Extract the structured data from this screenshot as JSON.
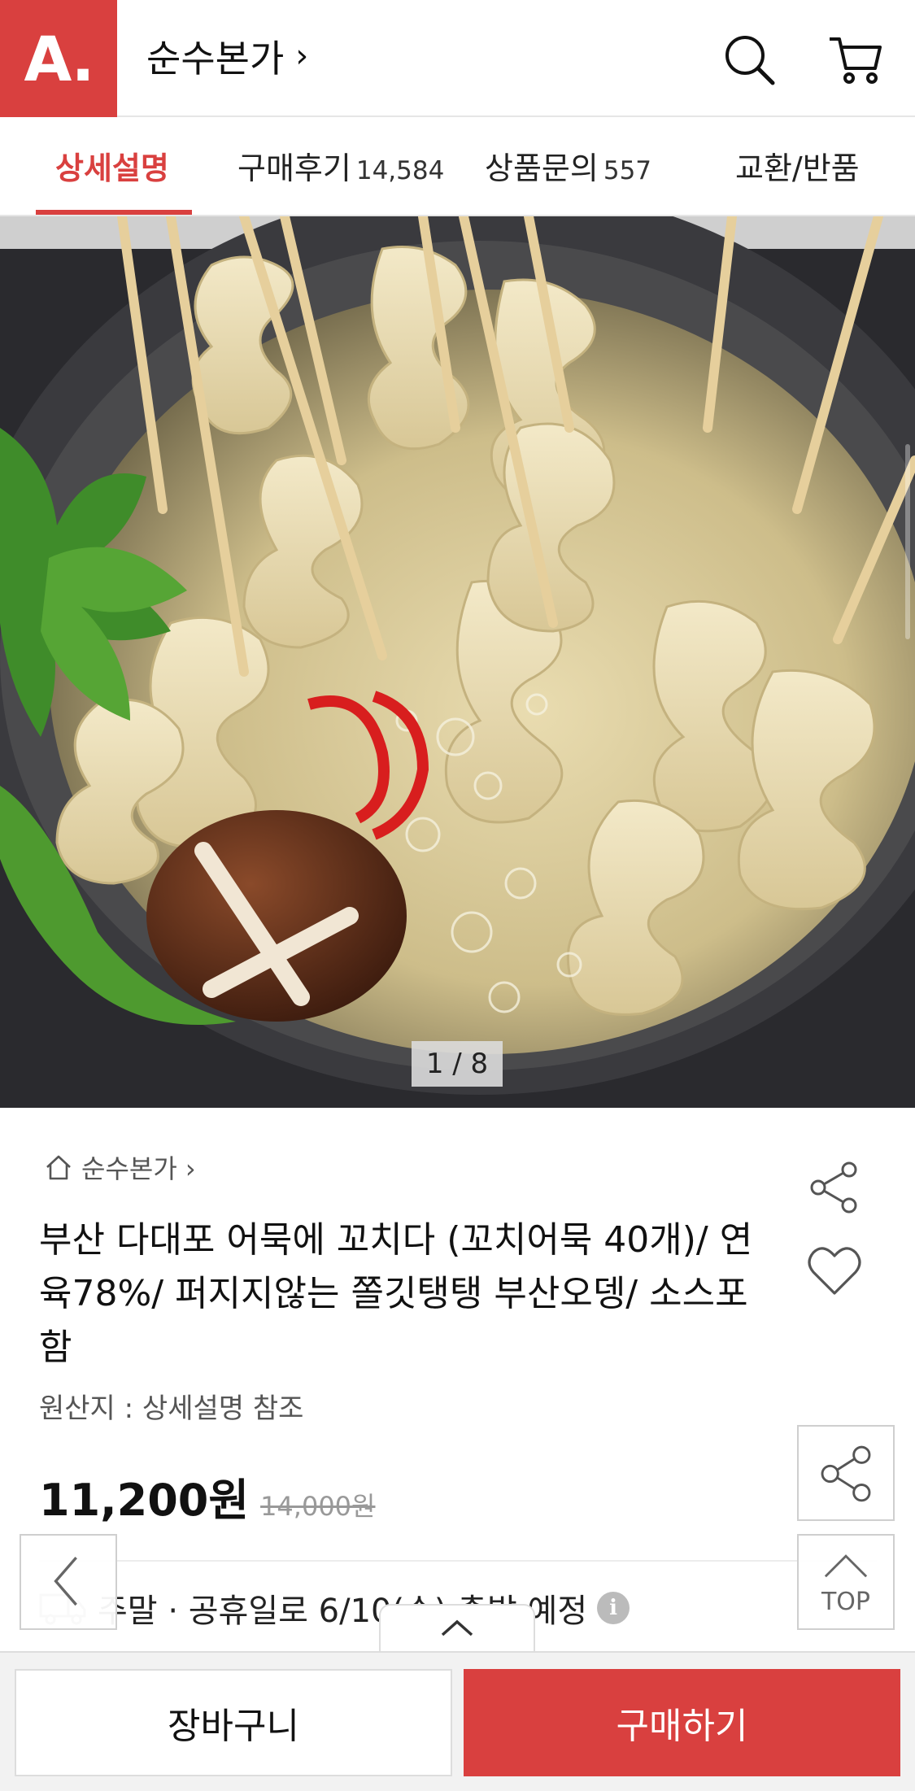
{
  "header": {
    "logo_text": "A.",
    "store_name": "순수본가",
    "chevron": "›",
    "icons": [
      "search-icon",
      "cart-icon"
    ]
  },
  "tabs": [
    {
      "label": "상세설명",
      "count": "",
      "active": true
    },
    {
      "label": "구매후기",
      "count": "14,584",
      "active": false
    },
    {
      "label": "상품문의",
      "count": "557",
      "active": false
    },
    {
      "label": "교환/반품",
      "count": "",
      "active": false
    }
  ],
  "gallery": {
    "counter": "1 / 8",
    "current": 1,
    "total": 8
  },
  "product": {
    "breadcrumb": "순수본가 ›",
    "title": "부산 다대포 어묵에 꼬치다 (꼬치어묵 40개)/ 연육78%/ 퍼지지않는 쫄깃탱탱 부산오뎅/ 소스포함",
    "origin": "원산지 : 상세설명 참조",
    "price": "11,200원",
    "original_price": "14,000원",
    "shipping": "주말 · 공휴일로 6/10(수) 출발 예정"
  },
  "floating": {
    "top_label": "TOP"
  },
  "bottom": {
    "cart_label": "장바구니",
    "buy_label": "구매하기"
  },
  "colors": {
    "accent": "#d9403f",
    "text": "#111111",
    "muted": "#999999"
  }
}
